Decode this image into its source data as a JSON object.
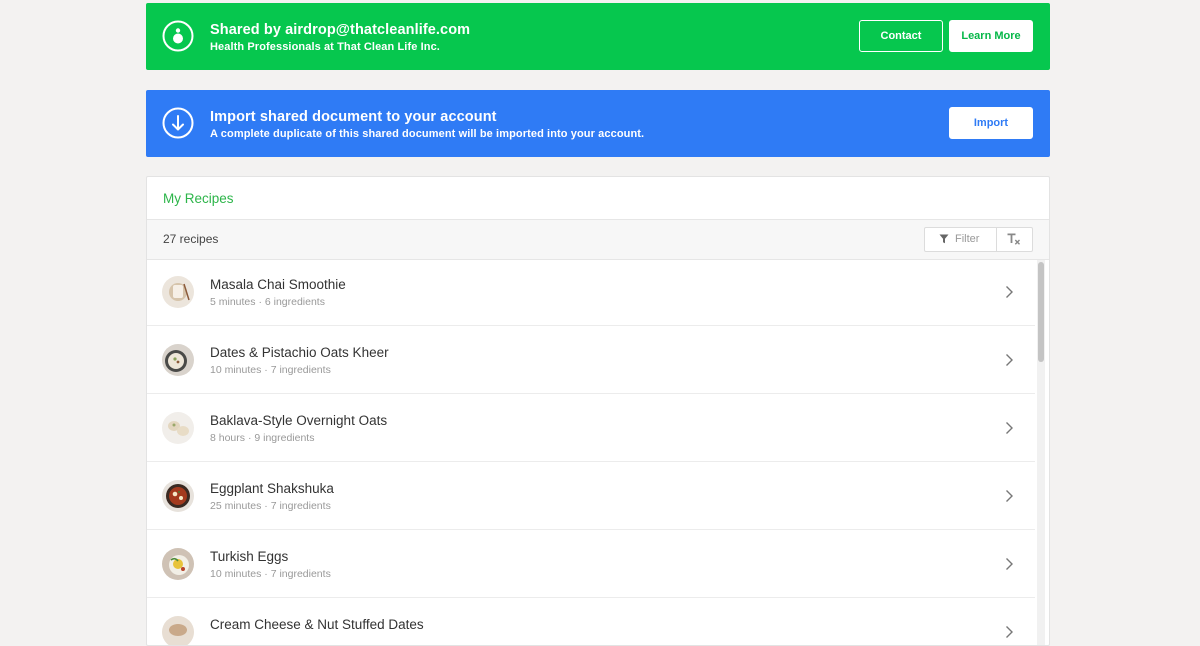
{
  "share_banner": {
    "title": "Shared by airdrop@thatcleanlife.com",
    "subtitle": "Health Professionals at That Clean Life Inc.",
    "contact_label": "Contact",
    "learn_more_label": "Learn More",
    "color": "#06c74e"
  },
  "import_banner": {
    "title": "Import shared document to your account",
    "subtitle": "A complete duplicate of this shared document will be imported into your account.",
    "import_label": "Import",
    "color": "#2f7bf5"
  },
  "recipes": {
    "title": "My Recipes",
    "count_label": "27 recipes",
    "filter_label": "Filter",
    "items": [
      {
        "name": "Masala Chai Smoothie",
        "meta": "5 minutes · 6 ingredients",
        "thumb": "#d8c7b0"
      },
      {
        "name": "Dates & Pistachio Oats Kheer",
        "meta": "10 minutes · 7 ingredients",
        "thumb": "#b8a894"
      },
      {
        "name": "Baklava-Style Overnight Oats",
        "meta": "8 hours · 9 ingredients",
        "thumb": "#e6dccb"
      },
      {
        "name": "Eggplant Shakshuka",
        "meta": "25 minutes · 7 ingredients",
        "thumb": "#8a3a22"
      },
      {
        "name": "Turkish Eggs",
        "meta": "10 minutes · 7 ingredients",
        "thumb": "#c9b77a"
      },
      {
        "name": "Cream Cheese & Nut Stuffed Dates",
        "meta": "",
        "thumb": "#c9a98a"
      }
    ]
  }
}
